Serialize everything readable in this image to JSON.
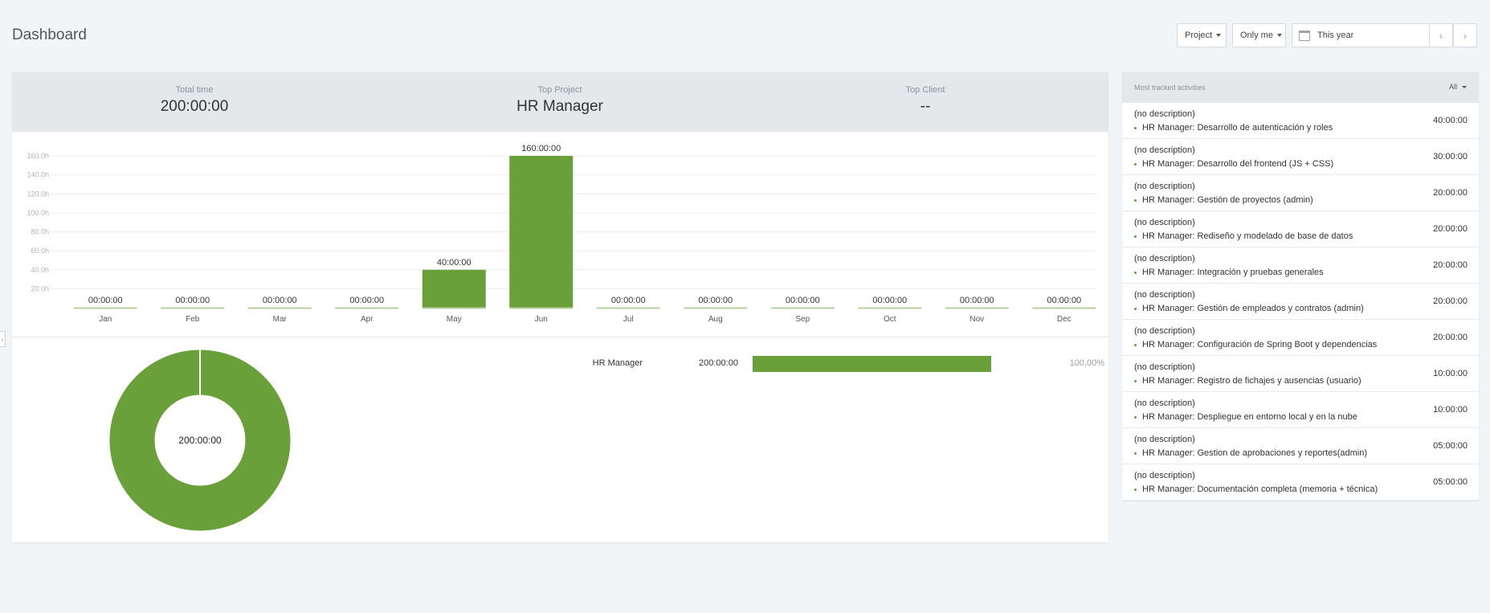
{
  "header": {
    "title": "Dashboard",
    "project_filter": "Project",
    "user_filter": "Only me",
    "date_range": "This year",
    "prev": "‹",
    "next": "›"
  },
  "summary": {
    "total_time_label": "Total time",
    "total_time": "200:00:00",
    "top_project_label": "Top Project",
    "top_project": "HR Manager",
    "top_client_label": "Top Client",
    "top_client": "--"
  },
  "chart_data": {
    "type": "bar",
    "categories": [
      "Jan",
      "Feb",
      "Mar",
      "Apr",
      "May",
      "Jun",
      "Jul",
      "Aug",
      "Sep",
      "Oct",
      "Nov",
      "Dec"
    ],
    "values": [
      0,
      0,
      0,
      0,
      40,
      160,
      0,
      0,
      0,
      0,
      0,
      0
    ],
    "value_labels": [
      "00:00:00",
      "00:00:00",
      "00:00:00",
      "00:00:00",
      "40:00:00",
      "160:00:00",
      "00:00:00",
      "00:00:00",
      "00:00:00",
      "00:00:00",
      "00:00:00",
      "00:00:00"
    ],
    "y_ticks": [
      "20.0h",
      "40.0h",
      "60.0h",
      "80.0h",
      "100.0h",
      "120.0h",
      "140.0h",
      "160.0h"
    ],
    "ylim": [
      0,
      160
    ],
    "grid": true,
    "color": "#6aa03a"
  },
  "donut": {
    "label": "200:00:00",
    "color": "#6aa03a",
    "share": 1.0
  },
  "projects": [
    {
      "name": "HR Manager",
      "time": "200:00:00",
      "percent": "100,00%"
    }
  ],
  "activities": {
    "title": "Most tracked activities",
    "filter": "All",
    "items": [
      {
        "description": "(no description)",
        "project": "HR Manager: Desarrollo de autenticación y roles",
        "duration": "40:00:00"
      },
      {
        "description": "(no description)",
        "project": "HR Manager: Desarrollo del frontend (JS + CSS)",
        "duration": "30:00:00"
      },
      {
        "description": "(no description)",
        "project": "HR Manager: Gestión de proyectos (admin)",
        "duration": "20:00:00"
      },
      {
        "description": "(no description)",
        "project": "HR Manager: Rediseño y modelado de base de datos",
        "duration": "20:00:00"
      },
      {
        "description": "(no description)",
        "project": "HR Manager: Integración y pruebas generales",
        "duration": "20:00:00"
      },
      {
        "description": "(no description)",
        "project": "HR Manager: Gestión de empleados y contratos (admin)",
        "duration": "20:00:00"
      },
      {
        "description": "(no description)",
        "project": "HR Manager: Configuración de Spring Boot y dependencias",
        "duration": "20:00:00"
      },
      {
        "description": "(no description)",
        "project": "HR Manager: Registro de fichajes y ausencias (usuario)",
        "duration": "10:00:00"
      },
      {
        "description": "(no description)",
        "project": "HR Manager: Despliegue en entorno local y en la nube",
        "duration": "10:00:00"
      },
      {
        "description": "(no description)",
        "project": "HR Manager: Gestion de aprobaciones y reportes(admin)",
        "duration": "05:00:00"
      },
      {
        "description": "(no description)",
        "project": "HR Manager: Documentación completa (memoria + técnica)",
        "duration": "05:00:00"
      }
    ]
  }
}
